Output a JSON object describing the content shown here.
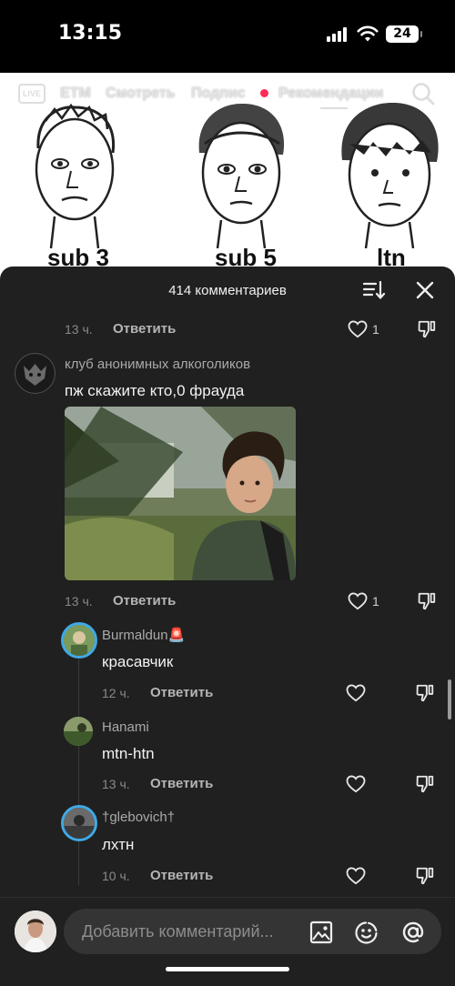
{
  "status_bar": {
    "time": "13:15",
    "battery": "24"
  },
  "top_nav": {
    "live_label": "LIVE",
    "tabs": [
      "ЕТМ",
      "Смотреть",
      "Подпис",
      "Рекомендации"
    ]
  },
  "video": {
    "labels": [
      "sub 3",
      "sub 5",
      "ltn"
    ]
  },
  "comments_sheet": {
    "title": "414 комментариев",
    "top_row": {
      "time": "13 ч.",
      "reply": "Ответить",
      "likes": "1"
    },
    "main_comment": {
      "username": "клуб анонимных алкоголиков",
      "text": "пж скажите кто,0 фрауда",
      "time": "13 ч.",
      "reply": "Ответить",
      "likes": "1"
    },
    "replies": [
      {
        "username": "Burmaldun🚨",
        "text": "красавчик",
        "time": "12 ч.",
        "reply": "Ответить"
      },
      {
        "username": "Hanami",
        "text": "mtn-htn",
        "time": "13 ч.",
        "reply": "Ответить"
      },
      {
        "username": "†glebovich†",
        "text": "лхтн",
        "time": "10 ч.",
        "reply": "Ответить"
      }
    ]
  },
  "input_bar": {
    "placeholder": "Добавить комментарий..."
  },
  "icons": {
    "sort": "sort-icon",
    "close": "close-icon",
    "heart": "heart-icon",
    "dislike": "dislike-icon",
    "image": "image-icon",
    "emoji": "emoji-icon",
    "mention": "at-icon"
  },
  "colors": {
    "sheet_bg": "#202020",
    "accent": "#fe2c55",
    "muted_text": "#8a8a8a"
  }
}
